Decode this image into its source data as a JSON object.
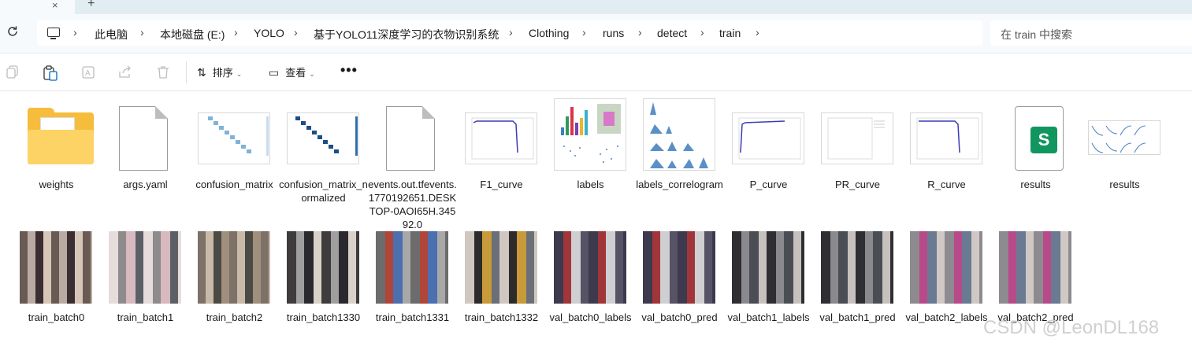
{
  "tabs": {
    "close_glyph": "×",
    "new_tab_glyph": "+"
  },
  "breadcrumb": {
    "items": [
      "此电脑",
      "本地磁盘 (E:)",
      "YOLO",
      "基于YOLO11深度学习的衣物识别系统",
      "Clothing",
      "runs",
      "detect",
      "train"
    ],
    "separator": "›"
  },
  "search": {
    "placeholder": "在 train 中搜索"
  },
  "toolbar": {
    "sort_label": "排序",
    "view_label": "查看",
    "more_label": "•••"
  },
  "files": [
    {
      "name": "weights",
      "kind": "folder"
    },
    {
      "name": "args.yaml",
      "kind": "document"
    },
    {
      "name": "confusion_matrix",
      "kind": "image-matrix"
    },
    {
      "name": "confusion_matrix_normalized",
      "kind": "image-matrix"
    },
    {
      "name": "events.out.tfevents.1770192651.DESKTOP-0AOI65H.34592.0",
      "kind": "document"
    },
    {
      "name": "F1_curve",
      "kind": "image-curve"
    },
    {
      "name": "labels",
      "kind": "image-labels"
    },
    {
      "name": "labels_correlogram",
      "kind": "image-correlogram"
    },
    {
      "name": "P_curve",
      "kind": "image-curve"
    },
    {
      "name": "PR_curve",
      "kind": "image-blank"
    },
    {
      "name": "R_curve",
      "kind": "image-curve"
    },
    {
      "name": "results",
      "kind": "spreadsheet"
    },
    {
      "name": "results",
      "kind": "image-results"
    },
    {
      "name": "train_batch0",
      "kind": "photo"
    },
    {
      "name": "train_batch1",
      "kind": "photo"
    },
    {
      "name": "train_batch2",
      "kind": "photo"
    },
    {
      "name": "train_batch1330",
      "kind": "photo"
    },
    {
      "name": "train_batch1331",
      "kind": "photo"
    },
    {
      "name": "train_batch1332",
      "kind": "photo"
    },
    {
      "name": "val_batch0_labels",
      "kind": "photo"
    },
    {
      "name": "val_batch0_pred",
      "kind": "photo"
    },
    {
      "name": "val_batch1_labels",
      "kind": "photo"
    },
    {
      "name": "val_batch1_pred",
      "kind": "photo"
    },
    {
      "name": "val_batch2_labels",
      "kind": "photo"
    },
    {
      "name": "val_batch2_pred",
      "kind": "photo"
    }
  ],
  "spreadsheet_badge": "S",
  "watermark": "CSDN @LeonDL168",
  "colors": {
    "folder": "#f5bd3b",
    "sheet": "#129660",
    "accent": "#0067c0"
  }
}
